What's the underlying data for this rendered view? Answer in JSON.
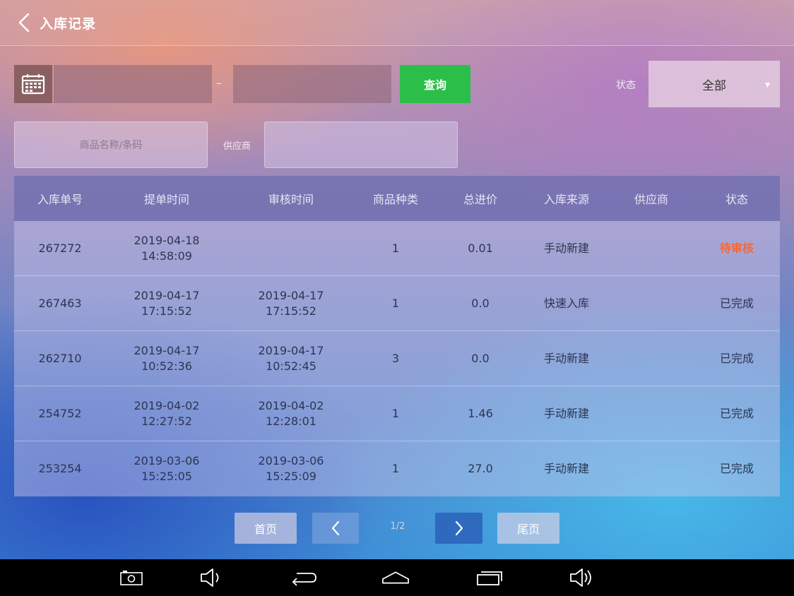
{
  "header": {
    "title": "入库记录"
  },
  "filters": {
    "start_date_value": "",
    "end_date_value": "",
    "date_separator": "–",
    "query_label": "查询",
    "status_label": "状态",
    "status_value": "全部",
    "product_placeholder": "商品名称/条码",
    "supplier_label": "供应商",
    "supplier_value": ""
  },
  "table": {
    "columns": [
      "入库单号",
      "提单时间",
      "审核时间",
      "商品种类",
      "总进价",
      "入库来源",
      "供应商",
      "状态"
    ],
    "rows": [
      {
        "id": "267272",
        "submit_date": "2019-04-18",
        "submit_time": "14:58:09",
        "review_date": "",
        "review_time": "",
        "kinds": "1",
        "total": "0.01",
        "source": "手动新建",
        "supplier": "",
        "status": "待审核"
      },
      {
        "id": "267463",
        "submit_date": "2019-04-17",
        "submit_time": "17:15:52",
        "review_date": "2019-04-17",
        "review_time": "17:15:52",
        "kinds": "1",
        "total": "0.0",
        "source": "快速入库",
        "supplier": "",
        "status": "已完成"
      },
      {
        "id": "262710",
        "submit_date": "2019-04-17",
        "submit_time": "10:52:36",
        "review_date": "2019-04-17",
        "review_time": "10:52:45",
        "kinds": "3",
        "total": "0.0",
        "source": "手动新建",
        "supplier": "",
        "status": "已完成"
      },
      {
        "id": "254752",
        "submit_date": "2019-04-02",
        "submit_time": "12:27:52",
        "review_date": "2019-04-02",
        "review_time": "12:28:01",
        "kinds": "1",
        "total": "1.46",
        "source": "手动新建",
        "supplier": "",
        "status": "已完成"
      },
      {
        "id": "253254",
        "submit_date": "2019-03-06",
        "submit_time": "15:25:05",
        "review_date": "2019-03-06",
        "review_time": "15:25:09",
        "kinds": "1",
        "total": "27.0",
        "source": "手动新建",
        "supplier": "",
        "status": "已完成"
      }
    ]
  },
  "pagination": {
    "first_label": "首页",
    "last_label": "尾页",
    "page_indicator": "1/2"
  },
  "colors": {
    "query_button": "#2bbf4a",
    "pending_status": "#f06a3a",
    "navbar": "#000000"
  },
  "icons": {
    "back": "chevron-left-icon",
    "calendar": "calendar-icon",
    "dropdown": "caret-down-icon",
    "prev": "chevron-left-icon",
    "next": "chevron-right-icon",
    "screenshot": "camera-icon",
    "volume_down": "volume-down-icon",
    "nav_back": "back-arrow-icon",
    "home": "home-icon",
    "recents": "recents-icon",
    "volume_up": "volume-up-icon"
  }
}
